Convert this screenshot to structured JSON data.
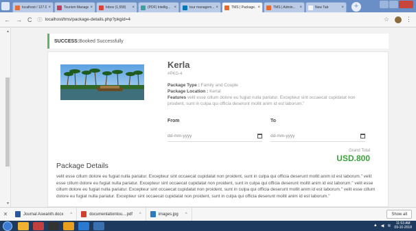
{
  "browser": {
    "tabs": [
      {
        "title": "localhost / 127.0.0.1",
        "fav": "#e0703a",
        "active": false
      },
      {
        "title": "Tourism Manage...",
        "fav": "#c04060",
        "active": false
      },
      {
        "title": "Inbox (1,558)",
        "fav": "#d44638",
        "active": false
      },
      {
        "title": "(PDF) Intellig...",
        "fav": "#3aa0a0",
        "active": false
      },
      {
        "title": "tour managem...",
        "fav": "#0077b5",
        "active": false
      },
      {
        "title": "TMS | Package...",
        "fav": "#e26d2b",
        "active": true
      },
      {
        "title": "TMS | Admin...",
        "fav": "#e26d2b",
        "active": false
      },
      {
        "title": "New Tab",
        "fav": "#f5f5f5",
        "active": false
      }
    ],
    "url": "localhost/tms/package-details.php?pkgid=4"
  },
  "alert": {
    "strong": "SUCCESS:",
    "text": "Booked Successfully"
  },
  "package": {
    "name": "Kerla",
    "id": "#PKG-4",
    "type_label": "Package Type :",
    "type_value": "Family and Couple",
    "location_label": "Package Location :",
    "location_value": "Kerlal",
    "features_label": "Features",
    "features_value": "velit esse cillum dolore eu fugiat nulla pariatur. Excepteur sint occaecat cupidatat non proident, sunt in culpa qui officia deserunt mollit anim id est laborum.\"",
    "from_label": "From",
    "to_label": "To",
    "from_placeholder": "dd-mm-yyyy",
    "to_placeholder": "dd-mm-yyyy",
    "grand_total_label": "Grand Total",
    "grand_total_value": "USD.800",
    "details_title": "Package Details",
    "details_body": "velit esse cillum dolore eu fugiat nulla pariatur. Excepteur sint occaecat cupidatat non proident, sunt in culpa qui officia deserunt mollit anim id est laborum.\" velit esse cillum dolore eu fugiat nulla pariatur. Excepteur sint occaecat cupidatat non proident, sunt in culpa qui officia deserunt mollit anim id est laborum.\" velit esse cillum dolore eu fugiat nulla pariatur. Excepteur sint occaecat cupidatat non proident, sunt in culpa qui officia deserunt mollit anim id est laborum.\" velit esse cillum dolore eu fugiat nulla pariatur. Excepteur sint occaecat cupidatat non proident, sunt in culpa qui officia deserunt mollit anim id est laborum.\""
  },
  "downloads": {
    "items": [
      {
        "name": "Journal Aswanth.docx",
        "color": "#2b5797"
      },
      {
        "name": "documentationtou....pdf",
        "color": "#d04030"
      },
      {
        "name": "images.jpg",
        "color": "#2b7bbf"
      }
    ],
    "show_all": "Show all"
  },
  "taskbar": {
    "icons": [
      "#f0b030",
      "#c04040",
      "#333333",
      "#e8a020",
      "#2a7bd0",
      "#3a6fb0"
    ],
    "time": "11:53 AM",
    "date": "09-10-2018"
  }
}
